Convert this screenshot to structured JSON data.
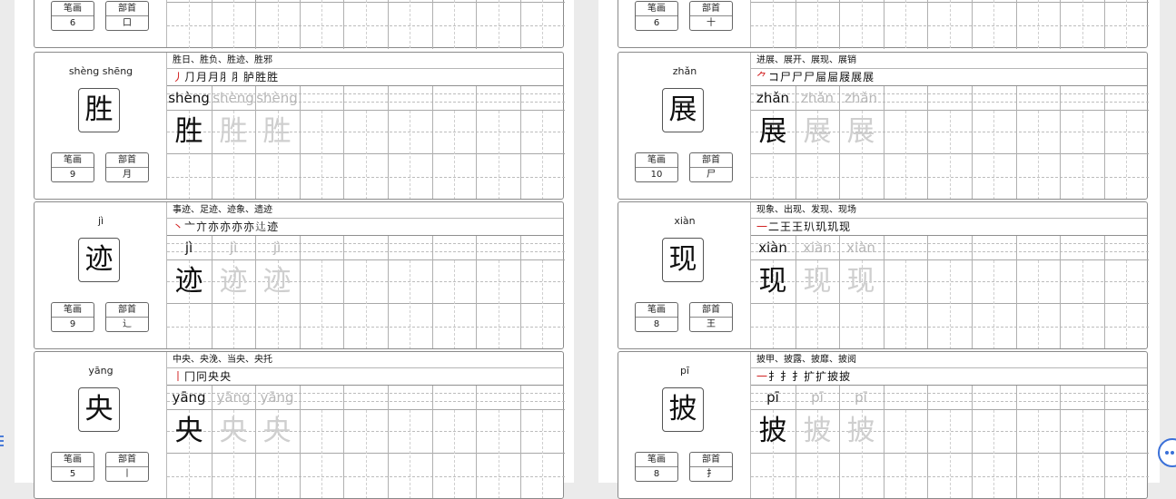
{
  "meta_labels": {
    "strokes": "笔画",
    "radical": "部首"
  },
  "colors": {
    "stroke_highlight": "#d22020",
    "accent": "#3a70d8"
  },
  "left_column": {
    "partial_card": {
      "stroke_count": "6",
      "radical": "口"
    },
    "cards": [
      {
        "pinyin": "shèng shēng",
        "char": "胜",
        "stroke_count": "9",
        "radical": "月",
        "words": "胜日、胜负、胜迹、胜邪",
        "stroke_order": [
          "丿",
          "⺆",
          "月",
          "月",
          "⺼",
          "⺼",
          "胪",
          "胜",
          "胜"
        ],
        "practice_pinyin": "shèng"
      },
      {
        "pinyin": "jì",
        "char": "迹",
        "stroke_count": "9",
        "radical": "辶",
        "words": "事迹、足迹、迹象、遗迹",
        "stroke_order": [
          "丶",
          "亠",
          "亣",
          "亦",
          "亦",
          "亦",
          "亦",
          "𨑒",
          "迹"
        ],
        "practice_pinyin": "jì"
      },
      {
        "pinyin": "yāng",
        "char": "央",
        "stroke_count": "5",
        "radical": "丨",
        "words": "中央、央浼、当央、央托",
        "stroke_order": [
          "丨",
          "冂",
          "冋",
          "央",
          "央"
        ],
        "practice_pinyin": "yāng"
      }
    ]
  },
  "right_column": {
    "partial_card": {
      "stroke_count": "6",
      "radical": "十"
    },
    "cards": [
      {
        "pinyin": "zhǎn",
        "char": "展",
        "stroke_count": "10",
        "radical": "尸",
        "words": "进展、展开、展现、展销",
        "stroke_order": [
          "⺈",
          "コ",
          "尸",
          "尸",
          "尸",
          "屇",
          "屇",
          "屐",
          "展",
          "展"
        ],
        "practice_pinyin": "zhǎn"
      },
      {
        "pinyin": "xiàn",
        "char": "现",
        "stroke_count": "8",
        "radical": "王",
        "words": "现象、出现、发现、现场",
        "stroke_order": [
          "一",
          "二",
          "王",
          "王",
          "玐",
          "玑",
          "玑",
          "现"
        ],
        "practice_pinyin": "xiàn"
      },
      {
        "pinyin": "pī",
        "char": "披",
        "stroke_count": "8",
        "radical": "扌",
        "words": "披甲、披露、披靡、披阅",
        "stroke_order": [
          "一",
          "扌",
          "扌",
          "扌",
          "扩",
          "扩",
          "披",
          "披"
        ],
        "practice_pinyin": "pī"
      }
    ]
  },
  "icons": {
    "assistant": "chat-bubble-icon",
    "edge": "page-edge-marker-icon"
  }
}
